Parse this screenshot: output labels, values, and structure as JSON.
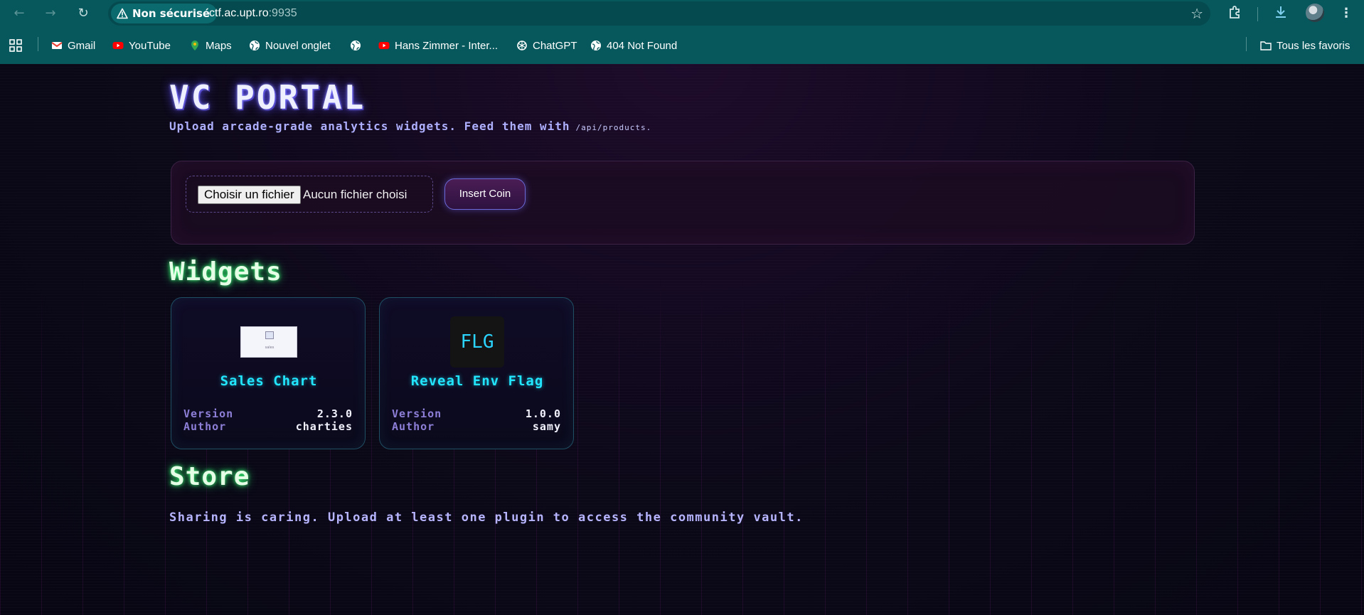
{
  "browser": {
    "security_label": "Non sécurisé",
    "url_host": "ctf.ac.upt.ro",
    "url_port": ":9935",
    "bookmarks": [
      {
        "label": "Gmail",
        "icon": "gmail-icon"
      },
      {
        "label": "YouTube",
        "icon": "youtube-icon"
      },
      {
        "label": "Maps",
        "icon": "maps-icon"
      },
      {
        "label": "Nouvel onglet",
        "icon": "globe-icon"
      },
      {
        "label": "",
        "icon": "globe-icon"
      },
      {
        "label": "Hans Zimmer - Inter...",
        "icon": "youtube-icon"
      },
      {
        "label": "ChatGPT",
        "icon": "chatgpt-icon"
      },
      {
        "label": "404 Not Found",
        "icon": "globe-icon"
      }
    ],
    "all_bookmarks_label": "Tous les favoris",
    "colors": {
      "chrome": "#07585c",
      "omnibox": "#054a4e"
    }
  },
  "header": {
    "title": "VC PORTAL",
    "subtitle": "Upload arcade-grade analytics widgets. Feed them with",
    "subtitle_code": "/api/products."
  },
  "upload": {
    "file_button_label": "Choisir un fichier",
    "file_status": "Aucun fichier choisi",
    "submit_label": "Insert Coin"
  },
  "widgets": {
    "heading": "Widgets",
    "items": [
      {
        "title": "Sales Chart",
        "version_label": "Version",
        "version": "2.3.0",
        "author_label": "Author",
        "author": "charties",
        "thumb": "image",
        "thumb_alt": "sales"
      },
      {
        "title": "Reveal Env Flag",
        "version_label": "Version",
        "version": "1.0.0",
        "author_label": "Author",
        "author": "samy",
        "thumb": "text",
        "thumb_text": "FLG"
      }
    ]
  },
  "store": {
    "heading": "Store",
    "message": "Sharing is caring. Upload at least one plugin to access the community vault."
  },
  "theme": {
    "accent_cyan": "#22e6ff",
    "accent_green": "#3cff7a",
    "accent_purple": "#8d7fd8"
  }
}
